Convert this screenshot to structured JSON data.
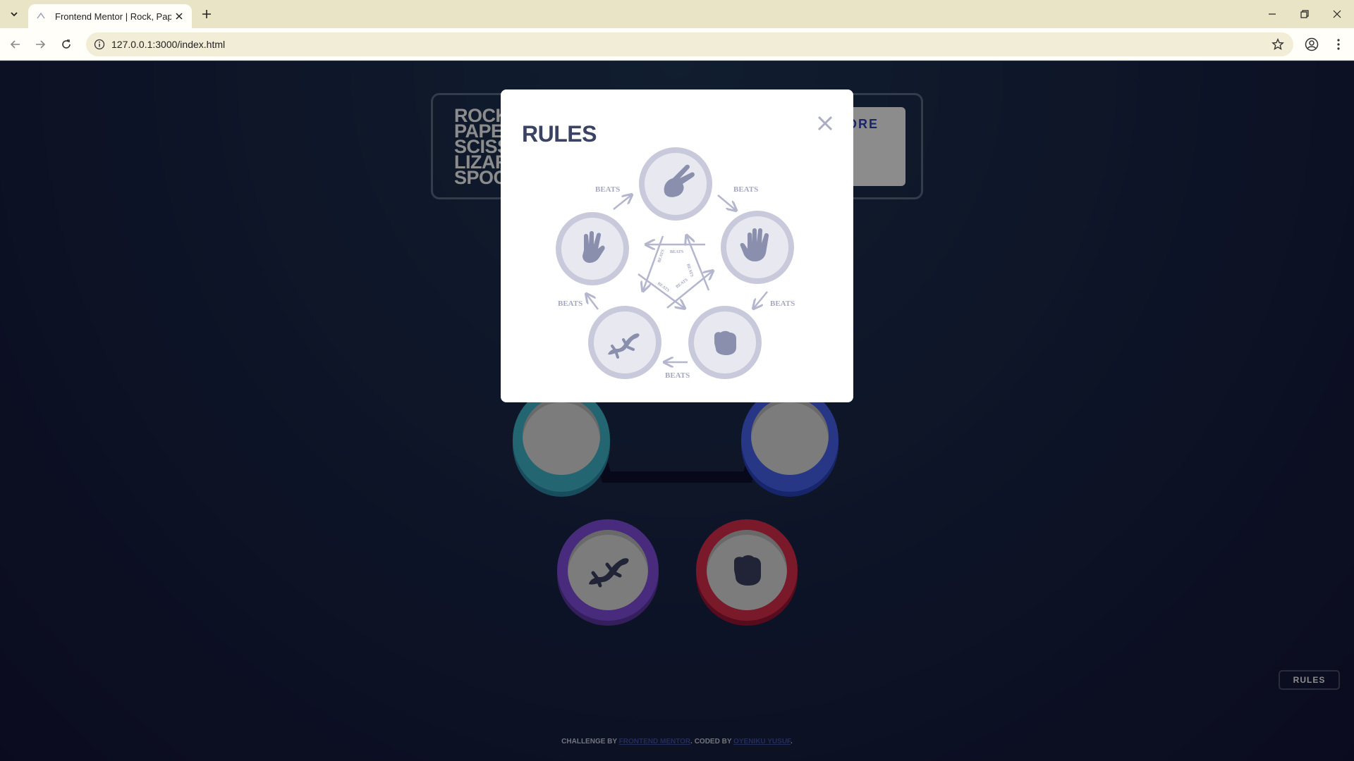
{
  "browser": {
    "tab_title": "Frontend Mentor | Rock, Paper, Scissors",
    "url": "127.0.0.1:3000/index.html",
    "icons": {
      "tab_dropdown": "chevron-down-icon",
      "favicon": "favicon-icon",
      "tab_close": "close-icon",
      "new_tab": "plus-icon",
      "back": "arrow-left-icon",
      "forward": "arrow-right-icon",
      "reload": "reload-icon",
      "site_info": "info-icon",
      "bookmark": "star-icon",
      "profile": "profile-icon",
      "menu": "kebab-menu-icon",
      "minimize": "minimize-icon",
      "restore": "restore-icon",
      "close_window": "close-icon"
    }
  },
  "page": {
    "logo_lines": [
      "ROCK",
      "PAPER",
      "SCISSORS",
      "LIZARD",
      "SPOCK"
    ],
    "score_label": "SCORE",
    "score_value": "",
    "rules_button": "RULES",
    "attribution": {
      "prefix": "CHALLENGE BY ",
      "link1": "FRONTEND MENTOR",
      "middle": ". CODED BY ",
      "link2": "OYENIKU YUSUF",
      "suffix": "."
    },
    "tokens": [
      {
        "name": "scissors",
        "ring_color": "#eca922"
      },
      {
        "name": "paper",
        "ring_color": "#4865f4"
      },
      {
        "name": "rock",
        "ring_color": "#dc2e4e"
      },
      {
        "name": "lizard",
        "ring_color": "#834fe3"
      },
      {
        "name": "spock",
        "ring_color": "#40b9ce"
      }
    ]
  },
  "modal": {
    "title": "RULES",
    "beats_label": "BEATS",
    "diagram_color": "#b3b6cd",
    "icon_color": "#8a8fad"
  }
}
